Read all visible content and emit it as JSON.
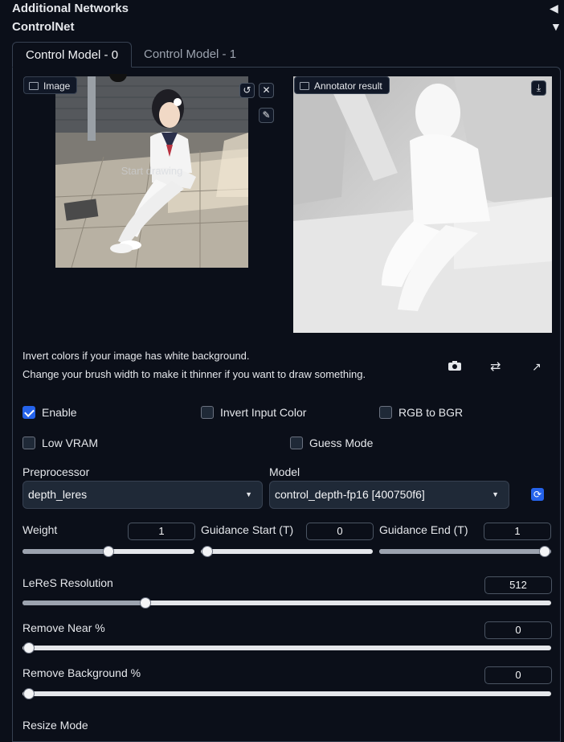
{
  "header": {
    "additional_networks": "Additional Networks",
    "controlnet": "ControlNet"
  },
  "tabs": [
    {
      "label": "Control Model - 0",
      "active": true
    },
    {
      "label": "Control Model - 1",
      "active": false
    }
  ],
  "image_panel": {
    "label": "Image",
    "overlay_text": "Start drawing"
  },
  "annotator_panel": {
    "label": "Annotator result"
  },
  "help": {
    "line1": "Invert colors if your image has white background.",
    "line2": "Change your brush width to make it thinner if you want to draw something."
  },
  "checkboxes": {
    "enable": {
      "label": "Enable",
      "checked": true
    },
    "invert_input_color": {
      "label": "Invert Input Color",
      "checked": false
    },
    "rgb_to_bgr": {
      "label": "RGB to BGR",
      "checked": false
    },
    "low_vram": {
      "label": "Low VRAM",
      "checked": false
    },
    "guess_mode": {
      "label": "Guess Mode",
      "checked": false
    }
  },
  "preprocessor": {
    "label": "Preprocessor",
    "value": "depth_leres"
  },
  "model": {
    "label": "Model",
    "value": "control_depth-fp16 [400750f6]"
  },
  "sliders": {
    "weight": {
      "label": "Weight",
      "value": "1",
      "min": 0,
      "max": 2,
      "fraction": 0.5
    },
    "guidance_start": {
      "label": "Guidance Start (T)",
      "value": "0",
      "fraction": 0.0
    },
    "guidance_end": {
      "label": "Guidance End (T)",
      "value": "1",
      "fraction": 1.0
    },
    "leres_resolution": {
      "label": "LeReS Resolution",
      "value": "512",
      "fraction": 0.22
    },
    "remove_near": {
      "label": "Remove Near %",
      "value": "0",
      "fraction": 0.0
    },
    "remove_background": {
      "label": "Remove Background %",
      "value": "0",
      "fraction": 0.0
    }
  },
  "resize_mode": {
    "label": "Resize Mode"
  },
  "colors": {
    "accent": "#2563eb",
    "background": "#0b0f19",
    "border": "#374151"
  }
}
